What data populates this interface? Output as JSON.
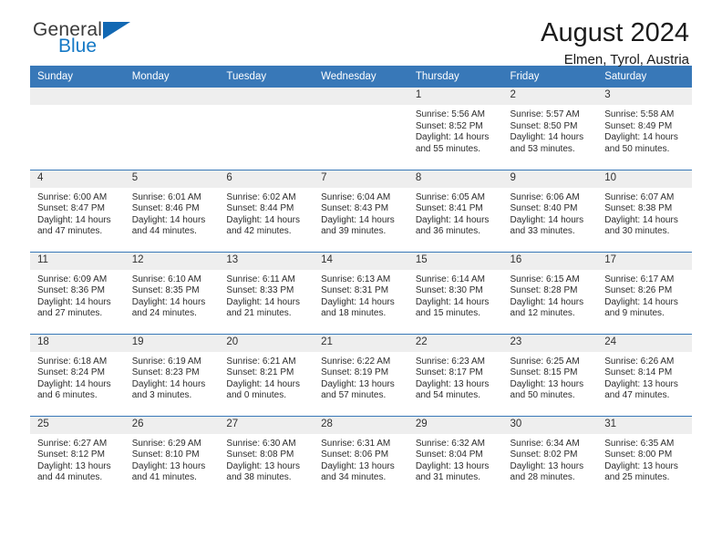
{
  "brand": {
    "name_part1": "General",
    "name_part2": "Blue",
    "flag_icon": "blue-triangle-flag-icon"
  },
  "header": {
    "title": "August 2024",
    "location": "Elmen, Tyrol, Austria"
  },
  "calendar": {
    "accent_color": "#3878b8",
    "daynum_band_color": "#eeeeee",
    "weekday_headers": [
      "Sunday",
      "Monday",
      "Tuesday",
      "Wednesday",
      "Thursday",
      "Friday",
      "Saturday"
    ],
    "weeks": [
      [
        {
          "day": "",
          "empty": true,
          "sunrise": "",
          "sunset": "",
          "daylight_line1": "",
          "daylight_line2": ""
        },
        {
          "day": "",
          "empty": true,
          "sunrise": "",
          "sunset": "",
          "daylight_line1": "",
          "daylight_line2": ""
        },
        {
          "day": "",
          "empty": true,
          "sunrise": "",
          "sunset": "",
          "daylight_line1": "",
          "daylight_line2": ""
        },
        {
          "day": "",
          "empty": true,
          "sunrise": "",
          "sunset": "",
          "daylight_line1": "",
          "daylight_line2": ""
        },
        {
          "day": "1",
          "empty": false,
          "sunrise": "Sunrise: 5:56 AM",
          "sunset": "Sunset: 8:52 PM",
          "daylight_line1": "Daylight: 14 hours",
          "daylight_line2": "and 55 minutes."
        },
        {
          "day": "2",
          "empty": false,
          "sunrise": "Sunrise: 5:57 AM",
          "sunset": "Sunset: 8:50 PM",
          "daylight_line1": "Daylight: 14 hours",
          "daylight_line2": "and 53 minutes."
        },
        {
          "day": "3",
          "empty": false,
          "sunrise": "Sunrise: 5:58 AM",
          "sunset": "Sunset: 8:49 PM",
          "daylight_line1": "Daylight: 14 hours",
          "daylight_line2": "and 50 minutes."
        }
      ],
      [
        {
          "day": "4",
          "empty": false,
          "sunrise": "Sunrise: 6:00 AM",
          "sunset": "Sunset: 8:47 PM",
          "daylight_line1": "Daylight: 14 hours",
          "daylight_line2": "and 47 minutes."
        },
        {
          "day": "5",
          "empty": false,
          "sunrise": "Sunrise: 6:01 AM",
          "sunset": "Sunset: 8:46 PM",
          "daylight_line1": "Daylight: 14 hours",
          "daylight_line2": "and 44 minutes."
        },
        {
          "day": "6",
          "empty": false,
          "sunrise": "Sunrise: 6:02 AM",
          "sunset": "Sunset: 8:44 PM",
          "daylight_line1": "Daylight: 14 hours",
          "daylight_line2": "and 42 minutes."
        },
        {
          "day": "7",
          "empty": false,
          "sunrise": "Sunrise: 6:04 AM",
          "sunset": "Sunset: 8:43 PM",
          "daylight_line1": "Daylight: 14 hours",
          "daylight_line2": "and 39 minutes."
        },
        {
          "day": "8",
          "empty": false,
          "sunrise": "Sunrise: 6:05 AM",
          "sunset": "Sunset: 8:41 PM",
          "daylight_line1": "Daylight: 14 hours",
          "daylight_line2": "and 36 minutes."
        },
        {
          "day": "9",
          "empty": false,
          "sunrise": "Sunrise: 6:06 AM",
          "sunset": "Sunset: 8:40 PM",
          "daylight_line1": "Daylight: 14 hours",
          "daylight_line2": "and 33 minutes."
        },
        {
          "day": "10",
          "empty": false,
          "sunrise": "Sunrise: 6:07 AM",
          "sunset": "Sunset: 8:38 PM",
          "daylight_line1": "Daylight: 14 hours",
          "daylight_line2": "and 30 minutes."
        }
      ],
      [
        {
          "day": "11",
          "empty": false,
          "sunrise": "Sunrise: 6:09 AM",
          "sunset": "Sunset: 8:36 PM",
          "daylight_line1": "Daylight: 14 hours",
          "daylight_line2": "and 27 minutes."
        },
        {
          "day": "12",
          "empty": false,
          "sunrise": "Sunrise: 6:10 AM",
          "sunset": "Sunset: 8:35 PM",
          "daylight_line1": "Daylight: 14 hours",
          "daylight_line2": "and 24 minutes."
        },
        {
          "day": "13",
          "empty": false,
          "sunrise": "Sunrise: 6:11 AM",
          "sunset": "Sunset: 8:33 PM",
          "daylight_line1": "Daylight: 14 hours",
          "daylight_line2": "and 21 minutes."
        },
        {
          "day": "14",
          "empty": false,
          "sunrise": "Sunrise: 6:13 AM",
          "sunset": "Sunset: 8:31 PM",
          "daylight_line1": "Daylight: 14 hours",
          "daylight_line2": "and 18 minutes."
        },
        {
          "day": "15",
          "empty": false,
          "sunrise": "Sunrise: 6:14 AM",
          "sunset": "Sunset: 8:30 PM",
          "daylight_line1": "Daylight: 14 hours",
          "daylight_line2": "and 15 minutes."
        },
        {
          "day": "16",
          "empty": false,
          "sunrise": "Sunrise: 6:15 AM",
          "sunset": "Sunset: 8:28 PM",
          "daylight_line1": "Daylight: 14 hours",
          "daylight_line2": "and 12 minutes."
        },
        {
          "day": "17",
          "empty": false,
          "sunrise": "Sunrise: 6:17 AM",
          "sunset": "Sunset: 8:26 PM",
          "daylight_line1": "Daylight: 14 hours",
          "daylight_line2": "and 9 minutes."
        }
      ],
      [
        {
          "day": "18",
          "empty": false,
          "sunrise": "Sunrise: 6:18 AM",
          "sunset": "Sunset: 8:24 PM",
          "daylight_line1": "Daylight: 14 hours",
          "daylight_line2": "and 6 minutes."
        },
        {
          "day": "19",
          "empty": false,
          "sunrise": "Sunrise: 6:19 AM",
          "sunset": "Sunset: 8:23 PM",
          "daylight_line1": "Daylight: 14 hours",
          "daylight_line2": "and 3 minutes."
        },
        {
          "day": "20",
          "empty": false,
          "sunrise": "Sunrise: 6:21 AM",
          "sunset": "Sunset: 8:21 PM",
          "daylight_line1": "Daylight: 14 hours",
          "daylight_line2": "and 0 minutes."
        },
        {
          "day": "21",
          "empty": false,
          "sunrise": "Sunrise: 6:22 AM",
          "sunset": "Sunset: 8:19 PM",
          "daylight_line1": "Daylight: 13 hours",
          "daylight_line2": "and 57 minutes."
        },
        {
          "day": "22",
          "empty": false,
          "sunrise": "Sunrise: 6:23 AM",
          "sunset": "Sunset: 8:17 PM",
          "daylight_line1": "Daylight: 13 hours",
          "daylight_line2": "and 54 minutes."
        },
        {
          "day": "23",
          "empty": false,
          "sunrise": "Sunrise: 6:25 AM",
          "sunset": "Sunset: 8:15 PM",
          "daylight_line1": "Daylight: 13 hours",
          "daylight_line2": "and 50 minutes."
        },
        {
          "day": "24",
          "empty": false,
          "sunrise": "Sunrise: 6:26 AM",
          "sunset": "Sunset: 8:14 PM",
          "daylight_line1": "Daylight: 13 hours",
          "daylight_line2": "and 47 minutes."
        }
      ],
      [
        {
          "day": "25",
          "empty": false,
          "sunrise": "Sunrise: 6:27 AM",
          "sunset": "Sunset: 8:12 PM",
          "daylight_line1": "Daylight: 13 hours",
          "daylight_line2": "and 44 minutes."
        },
        {
          "day": "26",
          "empty": false,
          "sunrise": "Sunrise: 6:29 AM",
          "sunset": "Sunset: 8:10 PM",
          "daylight_line1": "Daylight: 13 hours",
          "daylight_line2": "and 41 minutes."
        },
        {
          "day": "27",
          "empty": false,
          "sunrise": "Sunrise: 6:30 AM",
          "sunset": "Sunset: 8:08 PM",
          "daylight_line1": "Daylight: 13 hours",
          "daylight_line2": "and 38 minutes."
        },
        {
          "day": "28",
          "empty": false,
          "sunrise": "Sunrise: 6:31 AM",
          "sunset": "Sunset: 8:06 PM",
          "daylight_line1": "Daylight: 13 hours",
          "daylight_line2": "and 34 minutes."
        },
        {
          "day": "29",
          "empty": false,
          "sunrise": "Sunrise: 6:32 AM",
          "sunset": "Sunset: 8:04 PM",
          "daylight_line1": "Daylight: 13 hours",
          "daylight_line2": "and 31 minutes."
        },
        {
          "day": "30",
          "empty": false,
          "sunrise": "Sunrise: 6:34 AM",
          "sunset": "Sunset: 8:02 PM",
          "daylight_line1": "Daylight: 13 hours",
          "daylight_line2": "and 28 minutes."
        },
        {
          "day": "31",
          "empty": false,
          "sunrise": "Sunrise: 6:35 AM",
          "sunset": "Sunset: 8:00 PM",
          "daylight_line1": "Daylight: 13 hours",
          "daylight_line2": "and 25 minutes."
        }
      ]
    ]
  }
}
